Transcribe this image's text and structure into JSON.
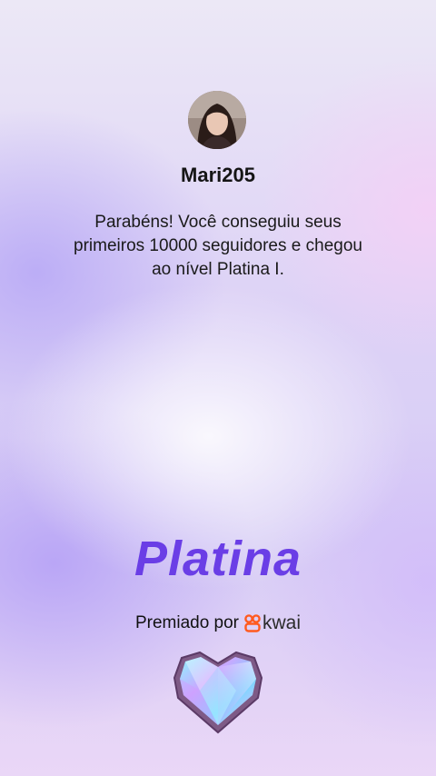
{
  "profile": {
    "username": "Mari205",
    "avatar_icon": "user-photo"
  },
  "message": "Parabéns! Você conseguiu seus primeiros 10000 seguidores e chegou ao nível Platina I.",
  "level": {
    "title": "Platina",
    "badge_icon": "platinum-heart-gem-icon"
  },
  "awarded": {
    "prefix": "Premiado por",
    "brand_name": "kwai",
    "brand_icon": "kwai-logo-icon"
  },
  "colors": {
    "level_title": "#6a3ee6",
    "brand": "#ff5a1f",
    "text": "#151515"
  }
}
